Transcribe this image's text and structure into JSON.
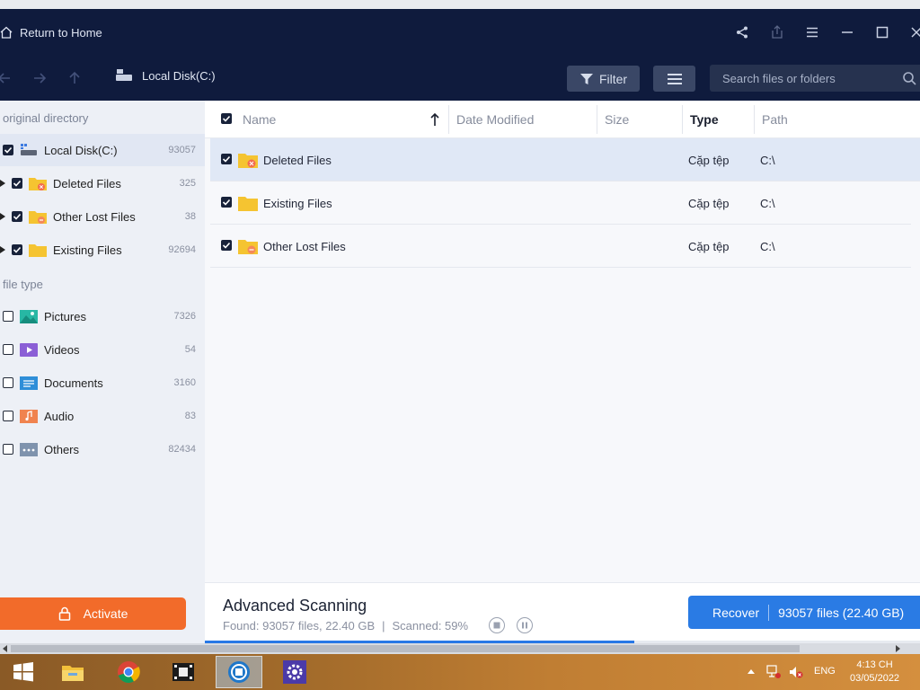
{
  "header": {
    "home_label": "Return to Home",
    "controls": [
      "share-icon",
      "upload-icon",
      "menu-icon",
      "minimize-icon",
      "maximize-icon",
      "close-icon"
    ]
  },
  "nav": {
    "location": "Local Disk(C:)",
    "filter_label": "Filter",
    "search_placeholder": "Search files or folders"
  },
  "sidebar": {
    "directory_section": "original directory",
    "directory_items": [
      {
        "label": "Local Disk(C:)",
        "count": "93057",
        "checked": true
      },
      {
        "label": "Deleted Files",
        "count": "325",
        "checked": true
      },
      {
        "label": "Other Lost Files",
        "count": "38",
        "checked": true
      },
      {
        "label": "Existing Files",
        "count": "92694",
        "checked": true
      }
    ],
    "type_section": "file type",
    "type_items": [
      {
        "label": "Pictures",
        "count": "7326",
        "checked": false
      },
      {
        "label": "Videos",
        "count": "54",
        "checked": false
      },
      {
        "label": "Documents",
        "count": "3160",
        "checked": false
      },
      {
        "label": "Audio",
        "count": "83",
        "checked": false
      },
      {
        "label": "Others",
        "count": "82434",
        "checked": false
      }
    ],
    "activate_label": "Activate"
  },
  "table": {
    "columns": {
      "name": "Name",
      "date": "Date Modified",
      "size": "Size",
      "type": "Type",
      "path": "Path"
    },
    "rows": [
      {
        "name": "Deleted Files",
        "type": "Cặp tệp",
        "path": "C:\\",
        "selected": true
      },
      {
        "name": "Existing Files",
        "type": "Cặp tệp",
        "path": "C:\\",
        "selected": false
      },
      {
        "name": "Other Lost Files",
        "type": "Cặp tệp",
        "path": "C:\\",
        "selected": false
      }
    ]
  },
  "footer": {
    "title": "Advanced Scanning",
    "found": "Found: 93057 files, 22.40 GB",
    "divider": "|",
    "scanned": "Scanned: 59%",
    "progress": 0.6,
    "recover_label": "Recover",
    "recover_detail": "93057 files (22.40 GB)"
  },
  "taskbar": {
    "apps": [
      "start-icon",
      "file-explorer-icon",
      "chrome-icon",
      "video-editor-icon",
      "recovery-app-icon",
      "settings-gear-icon"
    ],
    "language": "ENG",
    "time": "4:13 CH",
    "date": "03/05/2022"
  },
  "colors": {
    "titlebar": "#0f1b3d",
    "accent": "#2a7be4",
    "activate": "#f26b2a",
    "sidebar": "#edf0f6"
  }
}
